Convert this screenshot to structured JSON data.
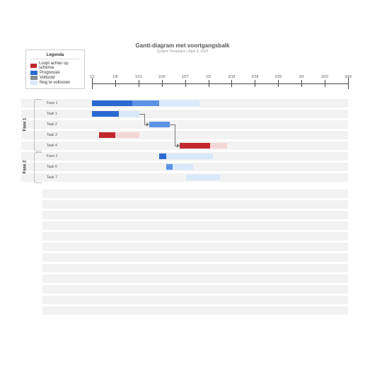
{
  "header": {
    "title": "Gantt-diagram met voortgangsbalk",
    "subtitle": "System Templates | April 3, 2023"
  },
  "legend": {
    "title": "Legenda",
    "items": [
      {
        "label": "Loopt achter op schema",
        "color": "#c1272d"
      },
      {
        "label": "Progressie",
        "color": "#2a6ad0"
      },
      {
        "label": "Voltooid",
        "color": "#8a8d91"
      },
      {
        "label": "Nog te voltooien",
        "color": "#d9e8fb"
      }
    ]
  },
  "colors": {
    "behind": "#c1272d",
    "behind_light": "#f3d6d6",
    "progress": "#2a6ad0",
    "progress_mid": "#5a93e6",
    "todo": "#d9e8fb",
    "done": "#8a8d91"
  },
  "chart_data": {
    "type": "gantt",
    "title": "Gantt-diagram met voortgangsbalk",
    "x_ticks": [
      "1/1",
      "1/8",
      "1/13",
      "1/20",
      "1/27",
      "2/3",
      "2/10",
      "2/18",
      "2/25",
      "3/3",
      "3/10",
      "3/18"
    ],
    "x_range": [
      0,
      76
    ],
    "phases": [
      {
        "name": "Fase 1",
        "rows": [
          0,
          1,
          2,
          3,
          4
        ]
      },
      {
        "name": "Fase 2",
        "rows": [
          5,
          6,
          7
        ]
      }
    ],
    "rows": [
      {
        "label": "Fase 1",
        "segments": [
          {
            "start": 0,
            "end": 12,
            "color": "progress"
          },
          {
            "start": 12,
            "end": 20,
            "color": "progress_mid"
          },
          {
            "start": 20,
            "end": 32,
            "color": "todo"
          }
        ]
      },
      {
        "label": "Taak 1",
        "segments": [
          {
            "start": 0,
            "end": 8,
            "color": "progress"
          },
          {
            "start": 8,
            "end": 14,
            "color": "todo"
          }
        ]
      },
      {
        "label": "Taak 2",
        "segments": [
          {
            "start": 17,
            "end": 23,
            "color": "progress_mid"
          }
        ],
        "arrow_from": {
          "row": 1,
          "x": 14
        }
      },
      {
        "label": "Taak 3",
        "segments": [
          {
            "start": 2,
            "end": 7,
            "color": "behind"
          },
          {
            "start": 7,
            "end": 14,
            "color": "behind_light"
          }
        ]
      },
      {
        "label": "Taak 4",
        "segments": [
          {
            "start": 26,
            "end": 35,
            "color": "behind"
          },
          {
            "start": 35,
            "end": 40,
            "color": "behind_light"
          }
        ],
        "arrow_from": {
          "row": 2,
          "x": 23
        }
      },
      {
        "label": "Fase 2",
        "segments": [
          {
            "start": 20,
            "end": 22,
            "color": "progress"
          },
          {
            "start": 22,
            "end": 36,
            "color": "todo"
          }
        ]
      },
      {
        "label": "Taak 6",
        "segments": [
          {
            "start": 22,
            "end": 24,
            "color": "progress_mid"
          },
          {
            "start": 24,
            "end": 30,
            "color": "todo"
          }
        ]
      },
      {
        "label": "Taak 7",
        "segments": [
          {
            "start": 28,
            "end": 38,
            "color": "todo"
          }
        ]
      }
    ],
    "filler_rows": 12
  }
}
